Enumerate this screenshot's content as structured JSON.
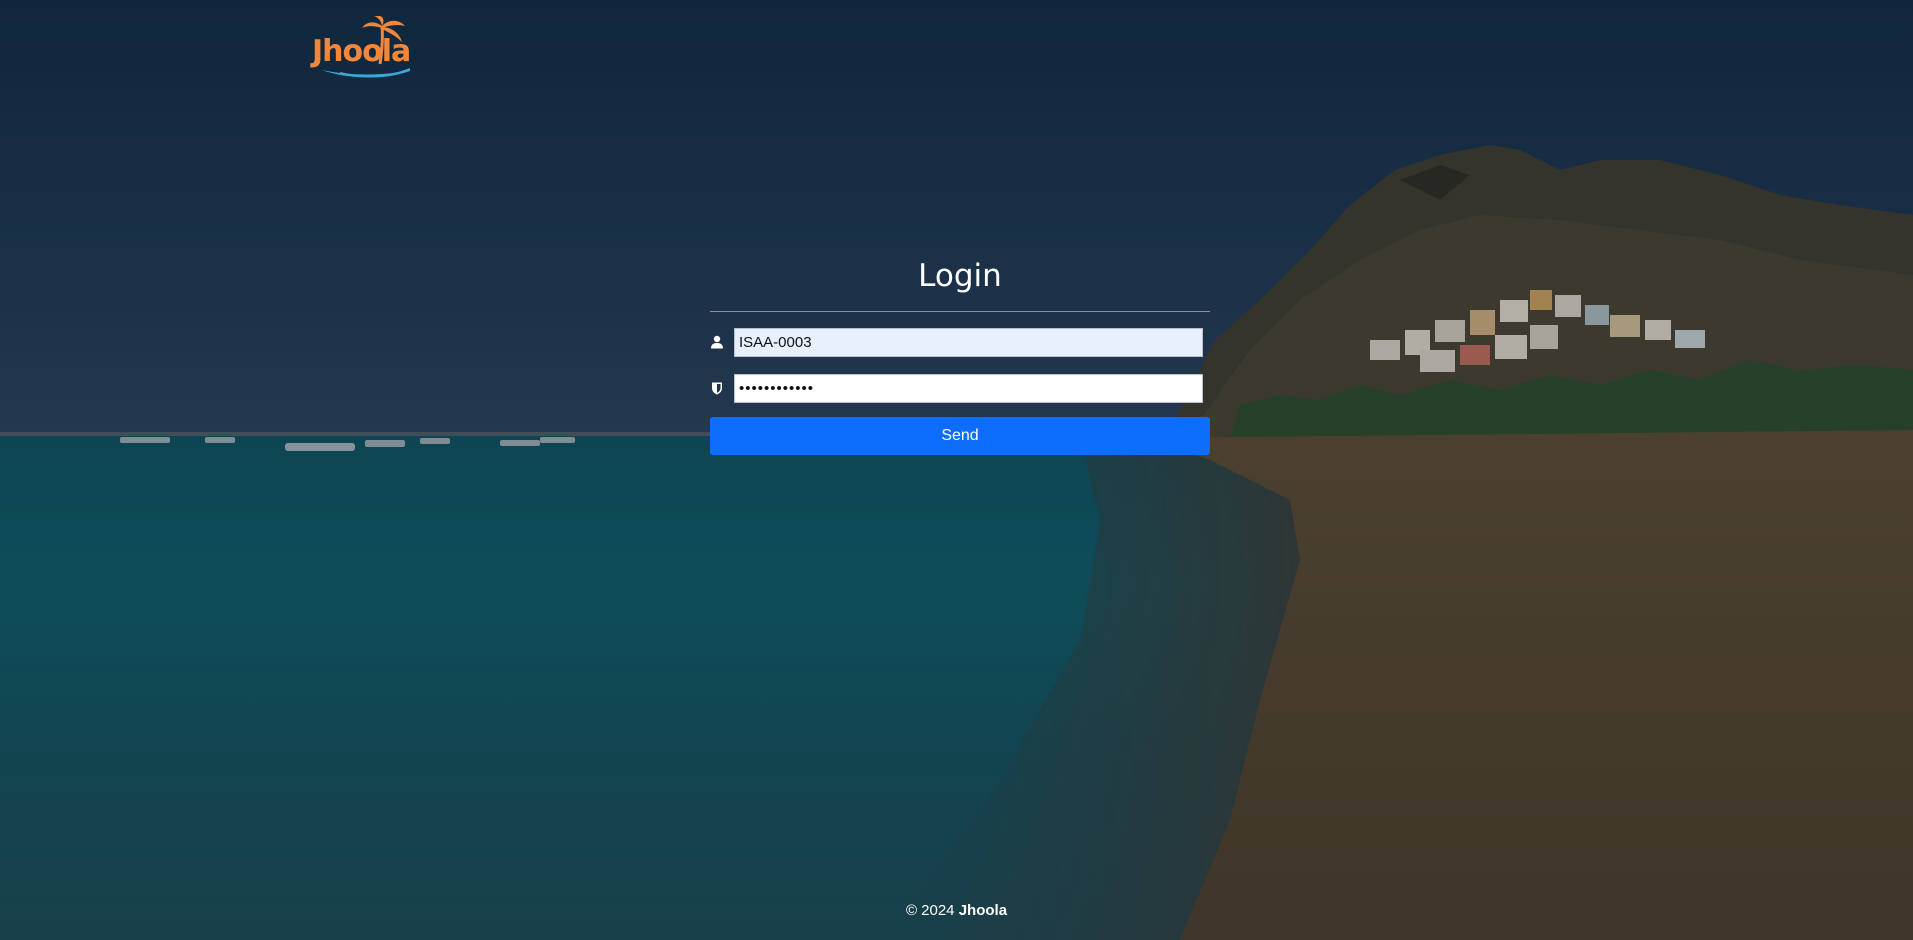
{
  "brand": {
    "logo_text": "Jhoola",
    "accent_color": "#f0873a"
  },
  "login": {
    "title": "Login",
    "username_value": "ISAA-0003",
    "password_value": "••••••••••••",
    "send_label": "Send",
    "button_color": "#0d6efd"
  },
  "icons": {
    "username": "user-icon",
    "password": "shield-icon"
  },
  "footer": {
    "copyright": "© 2024",
    "company": "Jhoola"
  }
}
